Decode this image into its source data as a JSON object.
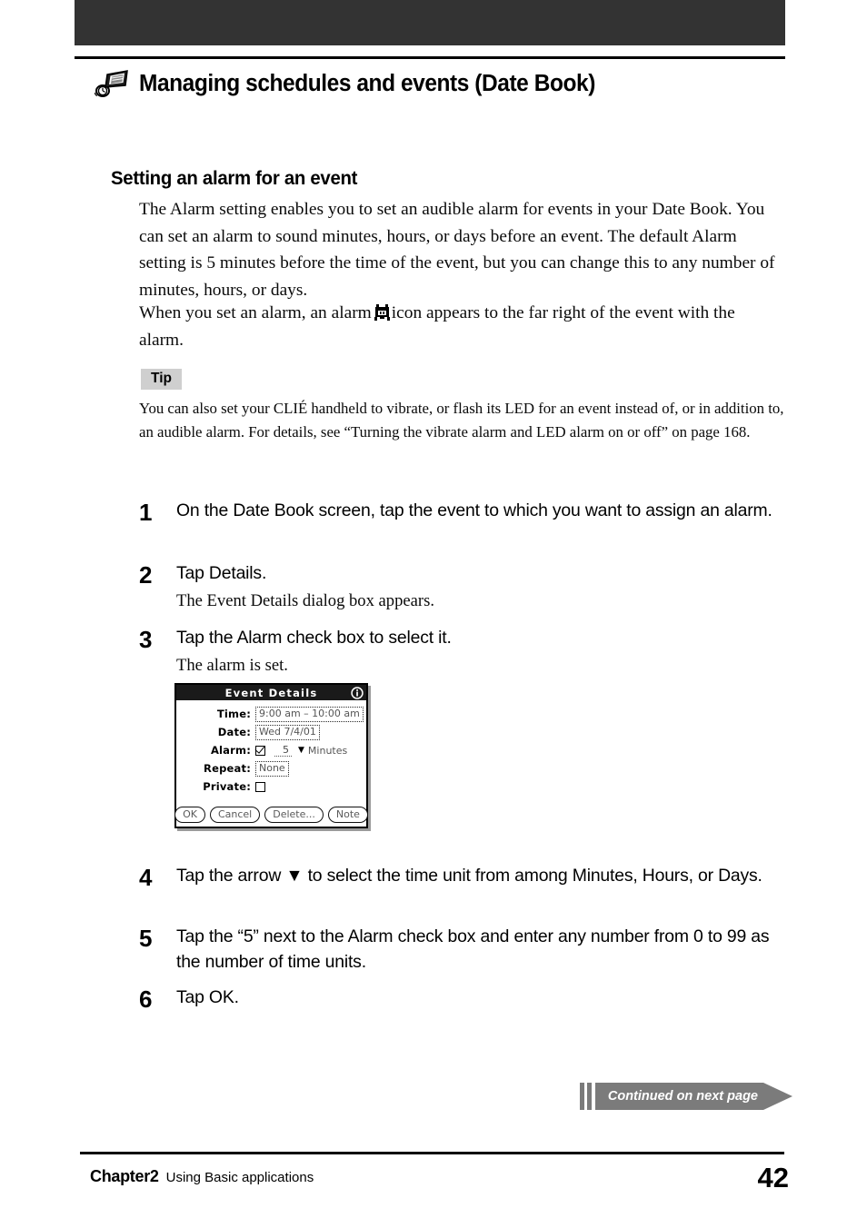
{
  "header": {
    "chapter_title": "Managing schedules and events (Date Book)",
    "icon": "date-book-clock-icon"
  },
  "section": {
    "heading": "Setting an alarm for an event",
    "paragraph_1_part_a": "The Alarm setting enables you to set an audible alarm for events in your Date Book. You can set an alarm to sound minutes, hours, or days before an event. The default Alarm setting is 5 minutes before the time of the event, but you can change this to any number of minutes, hours, or days.",
    "paragraph_2_before_icon": "When you set an alarm, an alarm",
    "paragraph_2_after_icon": "icon appears to the far right of the event with the alarm."
  },
  "tip": {
    "label": "Tip",
    "text": "You can also set your CLIÉ handheld to vibrate, or flash its LED for an event instead of, or in addition to, an audible alarm. For details, see “Turning the vibrate alarm and LED alarm on or off” on page 168."
  },
  "steps": [
    {
      "number": "1",
      "text": "On the Date Book screen, tap the event to which you want to assign an alarm.",
      "sub": ""
    },
    {
      "number": "2",
      "text": "Tap Details.",
      "sub": "The Event Details dialog box appears."
    },
    {
      "number": "3",
      "text": "Tap the Alarm check box to select it.",
      "sub": "The alarm is set."
    },
    {
      "number": "4",
      "text": "Tap the arrow ▼ to select the time unit from among Minutes, Hours, or Days.",
      "sub": ""
    },
    {
      "number": "5",
      "text": "Tap the “5” next to the Alarm check box and enter any number from 0 to 99 as the number of time units.",
      "sub": ""
    },
    {
      "number": "6",
      "text": "Tap OK.",
      "sub": ""
    }
  ],
  "pda_dialog": {
    "title": "Event Details",
    "info_icon": "info-icon",
    "rows": {
      "time_label": "Time:",
      "time_value": "9:00 am – 10:00 am",
      "date_label": "Date:",
      "date_value": "Wed 7/4/01",
      "alarm_label": "Alarm:",
      "alarm_amount": "5",
      "alarm_unit": "Minutes",
      "alarm_checked": true,
      "repeat_label": "Repeat:",
      "repeat_value": "None",
      "private_label": "Private:",
      "private_checked": false
    },
    "buttons": [
      "OK",
      "Cancel",
      "Delete...",
      "Note"
    ]
  },
  "continued": {
    "text": "Continued on next page"
  },
  "footer": {
    "chapter": "Chapter2",
    "subtitle": "Using Basic applications",
    "page_number": "42"
  },
  "colors": {
    "banner": "#333333",
    "tip_badge_bg": "#cfcfcf",
    "continued_bg": "#7b7b7b",
    "rule": "#000000"
  }
}
